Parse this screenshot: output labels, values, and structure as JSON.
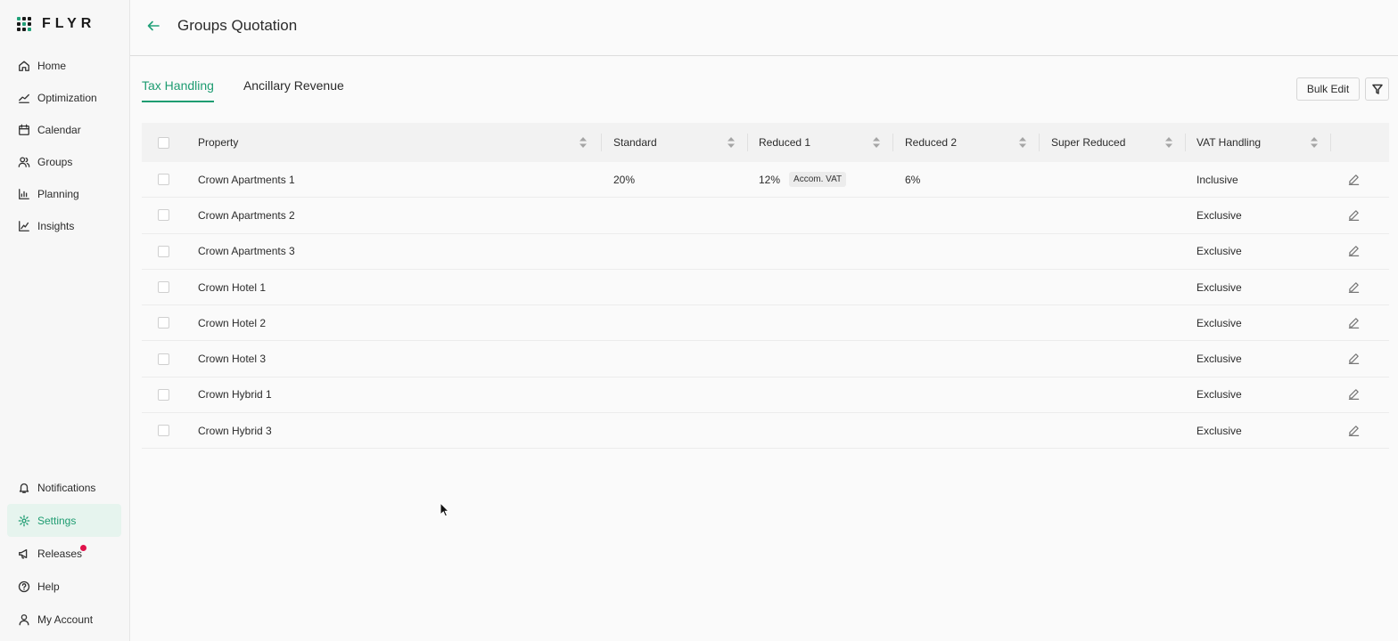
{
  "app": {
    "brand": "FLYR"
  },
  "nav": {
    "top": [
      {
        "label": "Home",
        "icon": "home-icon"
      },
      {
        "label": "Optimization",
        "icon": "trend-icon"
      },
      {
        "label": "Calendar",
        "icon": "calendar-icon"
      },
      {
        "label": "Groups",
        "icon": "users-icon"
      },
      {
        "label": "Planning",
        "icon": "bar-chart-icon"
      },
      {
        "label": "Insights",
        "icon": "line-chart-icon"
      }
    ],
    "bottom": [
      {
        "label": "Notifications",
        "icon": "bell-icon"
      },
      {
        "label": "Settings",
        "icon": "gear-icon",
        "active": true
      },
      {
        "label": "Releases",
        "icon": "megaphone-icon",
        "has_badge": true
      },
      {
        "label": "Help",
        "icon": "help-icon"
      },
      {
        "label": "My Account",
        "icon": "user-icon"
      }
    ]
  },
  "header": {
    "title": "Groups Quotation"
  },
  "tabs": [
    {
      "label": "Tax Handling",
      "active": true
    },
    {
      "label": "Ancillary Revenue",
      "active": false
    }
  ],
  "toolbar": {
    "bulk_edit_label": "Bulk Edit"
  },
  "table": {
    "columns": [
      "Property",
      "Standard",
      "Reduced 1",
      "Reduced 2",
      "Super Reduced",
      "VAT Handling"
    ],
    "rows": [
      {
        "property": "Crown Apartments 1",
        "standard": "20%",
        "reduced1": "12%",
        "reduced1_badge": "Accom. VAT",
        "reduced2": "6%",
        "super_reduced": "",
        "vat": "Inclusive"
      },
      {
        "property": "Crown Apartments 2",
        "standard": "",
        "reduced1": "",
        "reduced1_badge": "",
        "reduced2": "",
        "super_reduced": "",
        "vat": "Exclusive"
      },
      {
        "property": "Crown Apartments 3",
        "standard": "",
        "reduced1": "",
        "reduced1_badge": "",
        "reduced2": "",
        "super_reduced": "",
        "vat": "Exclusive"
      },
      {
        "property": "Crown Hotel 1",
        "standard": "",
        "reduced1": "",
        "reduced1_badge": "",
        "reduced2": "",
        "super_reduced": "",
        "vat": "Exclusive"
      },
      {
        "property": "Crown Hotel 2",
        "standard": "",
        "reduced1": "",
        "reduced1_badge": "",
        "reduced2": "",
        "super_reduced": "",
        "vat": "Exclusive"
      },
      {
        "property": "Crown Hotel 3",
        "standard": "",
        "reduced1": "",
        "reduced1_badge": "",
        "reduced2": "",
        "super_reduced": "",
        "vat": "Exclusive"
      },
      {
        "property": "Crown Hybrid 1",
        "standard": "",
        "reduced1": "",
        "reduced1_badge": "",
        "reduced2": "",
        "super_reduced": "",
        "vat": "Exclusive"
      },
      {
        "property": "Crown Hybrid 3",
        "standard": "",
        "reduced1": "",
        "reduced1_badge": "",
        "reduced2": "",
        "super_reduced": "",
        "vat": "Exclusive"
      }
    ]
  },
  "colors": {
    "accent": "#1e9c71",
    "badge_dot": "#e0124a"
  }
}
